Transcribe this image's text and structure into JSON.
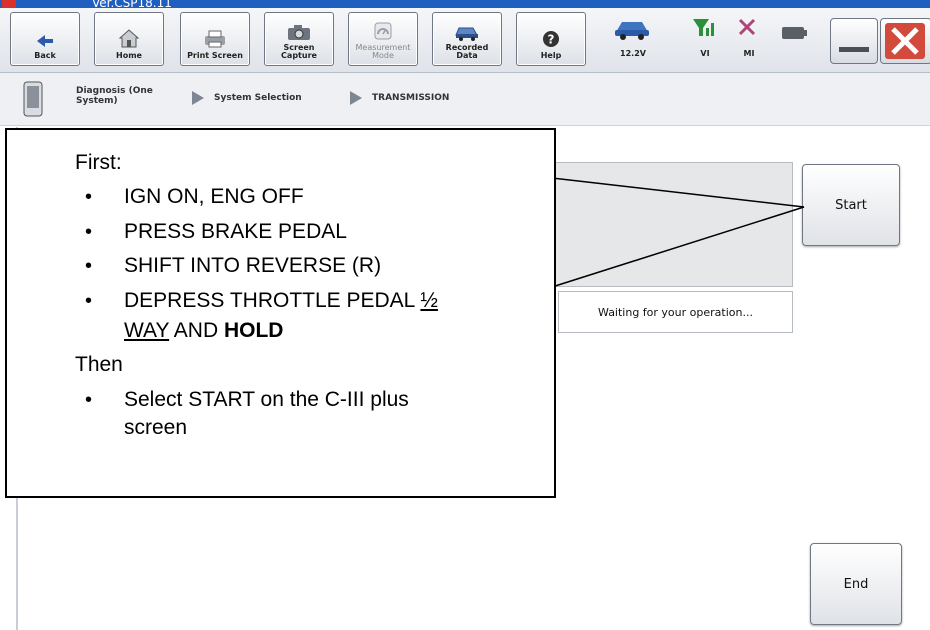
{
  "titlebar": {
    "version": "Ver.CSP18.11"
  },
  "toolbar": {
    "buttons": [
      {
        "label": "Back"
      },
      {
        "label": "Home"
      },
      {
        "label": "Print Screen"
      },
      {
        "label": "Screen Capture"
      },
      {
        "label": "Measurement Mode"
      },
      {
        "label": "Recorded Data"
      },
      {
        "label": "Help"
      }
    ],
    "status": {
      "voltage": "12.2V",
      "vi": "VI",
      "mi": "MI"
    }
  },
  "breadcrumb": {
    "items": [
      {
        "label": "Diagnosis (One System)"
      },
      {
        "label": "System Selection"
      },
      {
        "label": "TRANSMISSION"
      }
    ]
  },
  "callout": {
    "first": "First:",
    "steps": [
      "IGN ON, ENG OFF",
      "PRESS BRAKE PEDAL",
      "SHIFT INTO REVERSE (R)"
    ],
    "step4_part1": "DEPRESS THROTTLE PEDAL ",
    "step4_half": "½",
    "step4_way": "WAY",
    "step4_and": " AND ",
    "step4_hold": "HOLD",
    "then": "Then",
    "final_step_line1": "Select START on the C-III plus",
    "final_step_line2": "screen"
  },
  "main": {
    "start_button": "Start",
    "waiting_text": "Waiting for your operation...",
    "end_button": "End"
  }
}
